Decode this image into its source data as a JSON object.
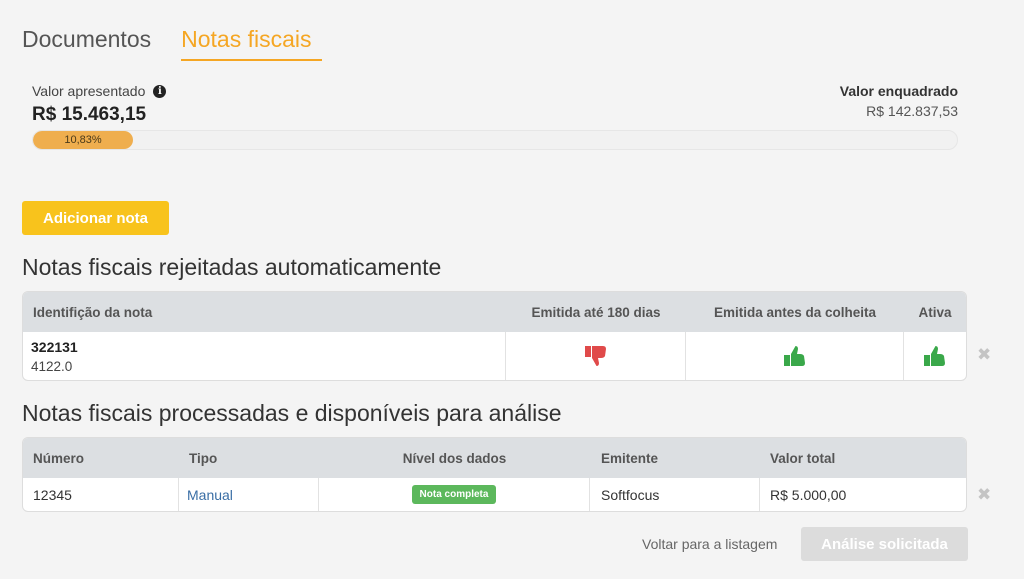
{
  "tabs": [
    {
      "label": "Documentos",
      "active": false
    },
    {
      "label": "Notas fiscais",
      "active": true
    }
  ],
  "progress": {
    "presented_label": "Valor apresentado",
    "presented_value": "R$ 15.463,15",
    "framed_label": "Valor enquadrado",
    "framed_value": "R$ 142.837,53",
    "percent_text": "10,83%",
    "percent": 10.83
  },
  "add_button_label": "Adicionar nota",
  "rejected": {
    "title": "Notas fiscais rejeitadas automaticamente",
    "headers": [
      "Identifição da nota",
      "Emitida até 180 dias",
      "Emitida antes da colheita",
      "Ativa"
    ],
    "rows": [
      {
        "id": "322131",
        "sub": "4122.0",
        "within_180": "thumbs-down",
        "before_harvest": "thumbs-up",
        "active": "thumbs-up"
      }
    ]
  },
  "processed": {
    "title": "Notas fiscais processadas e disponíveis para análise",
    "headers": [
      "Número",
      "Tipo",
      "Nível dos dados",
      "Emitente",
      "Valor total"
    ],
    "rows": [
      {
        "numero": "12345",
        "tipo": "Manual",
        "nivel": "Nota completa",
        "emitente": "Softfocus",
        "valor": "R$ 5.000,00"
      }
    ]
  },
  "footer": {
    "back_label": "Voltar para a listagem",
    "analysis_label": "Análise solicitada"
  },
  "colors": {
    "accent": "#f5a623",
    "thumb_up": "#3aa84a",
    "thumb_down": "#e04a4a",
    "badge": "#5cb85c"
  }
}
